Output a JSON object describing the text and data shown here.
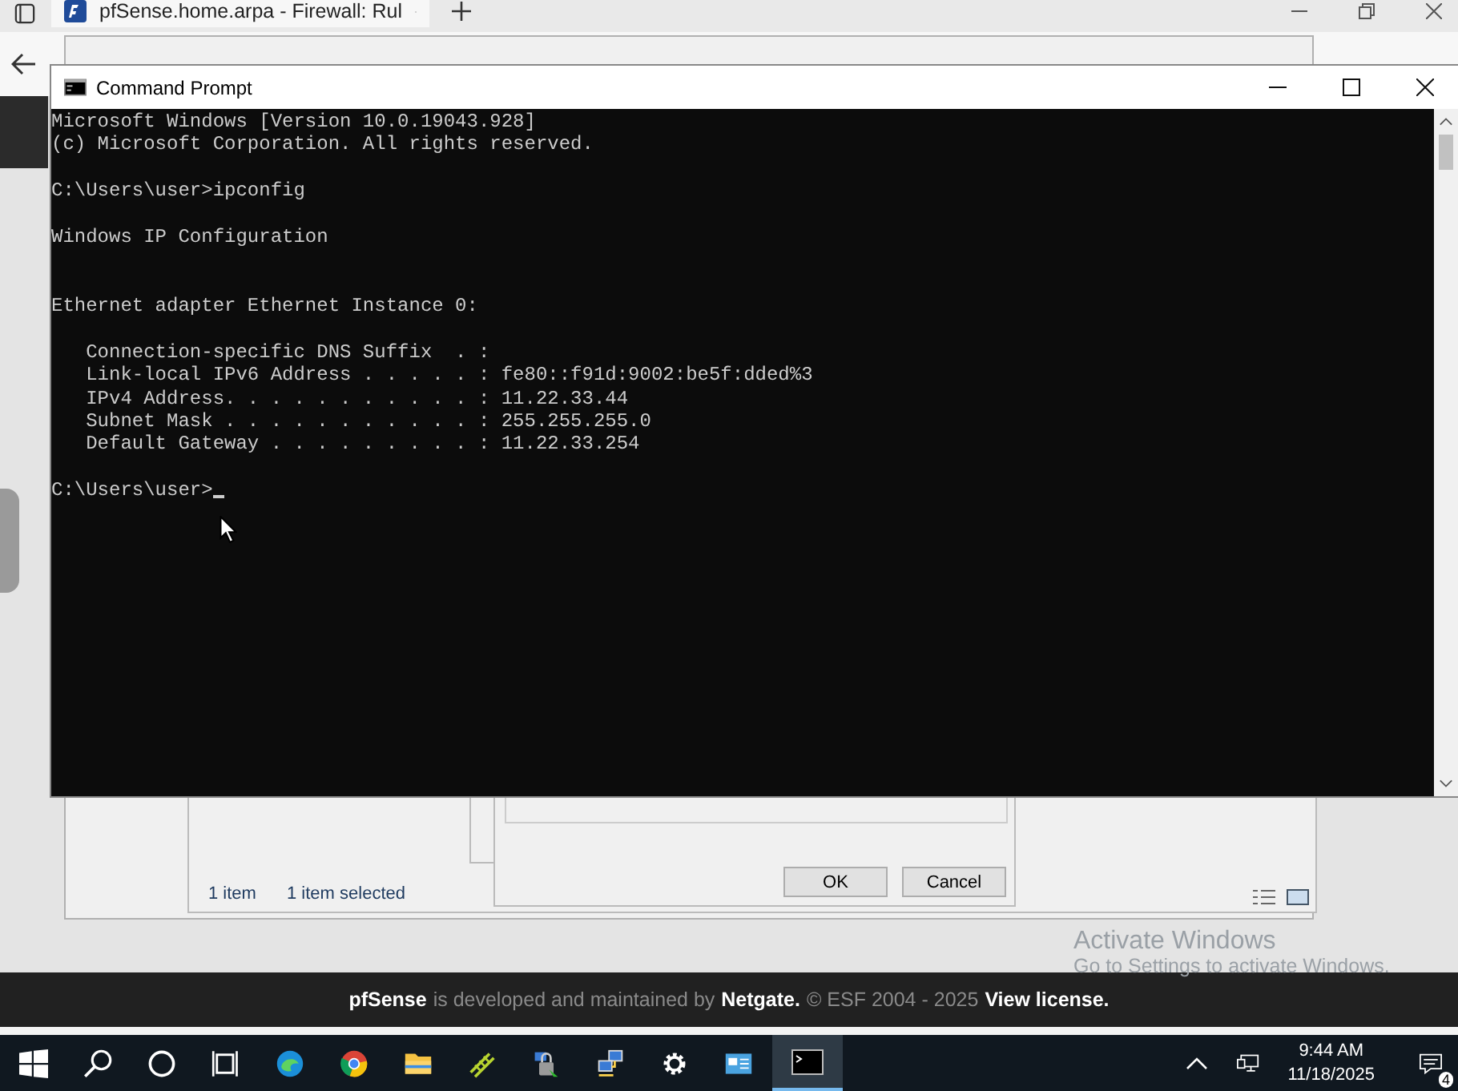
{
  "browser": {
    "tab_title": "pfSense.home.arpa - Firewall: Rul"
  },
  "command_prompt": {
    "title": "Command Prompt",
    "blocks": [
      {
        "extra_gap": false,
        "lines": [
          "Microsoft Windows [Version 10.0.19043.928]",
          "(c) Microsoft Corporation. All rights reserved."
        ]
      },
      {
        "extra_gap": false,
        "lines": [
          "C:\\Users\\user>ipconfig"
        ]
      },
      {
        "extra_gap": true,
        "lines": [
          "Windows IP Configuration"
        ]
      },
      {
        "extra_gap": false,
        "lines": [
          "Ethernet adapter Ethernet Instance 0:"
        ]
      },
      {
        "extra_gap": false,
        "lines": [
          "   Connection-specific DNS Suffix  . :",
          "   Link-local IPv6 Address . . . . . : fe80::f91d:9002:be5f:dded%3",
          "   IPv4 Address. . . . . . . . . . . : 11.22.33.44",
          "   Subnet Mask . . . . . . . . . . . : 255.255.255.0",
          "   Default Gateway . . . . . . . . . : 11.22.33.254"
        ]
      }
    ],
    "prompt": "C:\\Users\\user>"
  },
  "explorer_status": [
    "1 item",
    "1 item selected"
  ],
  "dialog_buttons": [
    "OK",
    "Cancel"
  ],
  "footer": {
    "brand": "pfSense",
    "middle": "is developed and maintained by",
    "company": "Netgate.",
    "copyright": "© ESF 2004 - 2025",
    "license_link": "View license."
  },
  "activation": {
    "title": "Activate Windows",
    "hint": "Go to Settings to activate Windows."
  },
  "taskbar": {
    "time": "9:44 AM",
    "date": "11/18/2025",
    "notifications": "4"
  }
}
